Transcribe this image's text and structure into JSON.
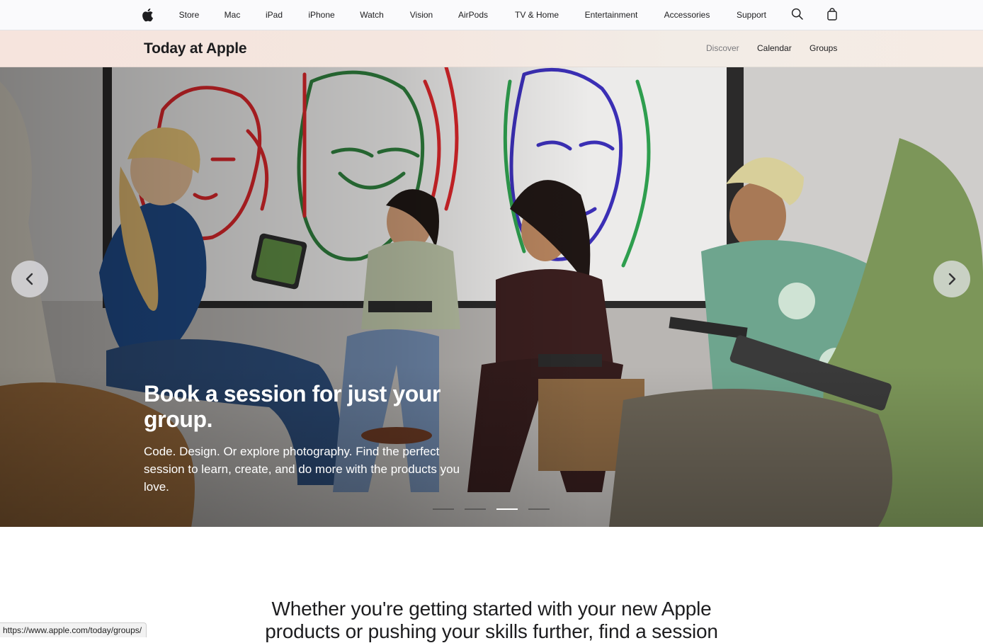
{
  "globalnav": {
    "items": [
      "Store",
      "Mac",
      "iPad",
      "iPhone",
      "Watch",
      "Vision",
      "AirPods",
      "TV & Home",
      "Entertainment",
      "Accessories",
      "Support"
    ],
    "icons": [
      "apple-logo-icon",
      "search-icon",
      "shopping-bag-icon"
    ]
  },
  "localnav": {
    "title": "Today at Apple",
    "links": [
      "Discover",
      "Calendar",
      "Groups"
    ],
    "current": "Discover"
  },
  "hero": {
    "headline": "Book a session for just your group.",
    "copy": "Code. Design. Or explore photography. Find the perfect session to learn, create, and do more with the products you love.",
    "slide_count": 4,
    "active_slide": 3,
    "icons": [
      "chevron-left-icon",
      "chevron-right-icon"
    ]
  },
  "intro": {
    "text": "Whether you're getting started with your new Apple products or pushing your skills further, find a session"
  },
  "status_bar": {
    "url": "https://www.apple.com/today/groups/"
  },
  "colors": {
    "text": "#1d1d1f",
    "nav_bg": "#fafafc",
    "current_link": "#7a7a7e"
  }
}
